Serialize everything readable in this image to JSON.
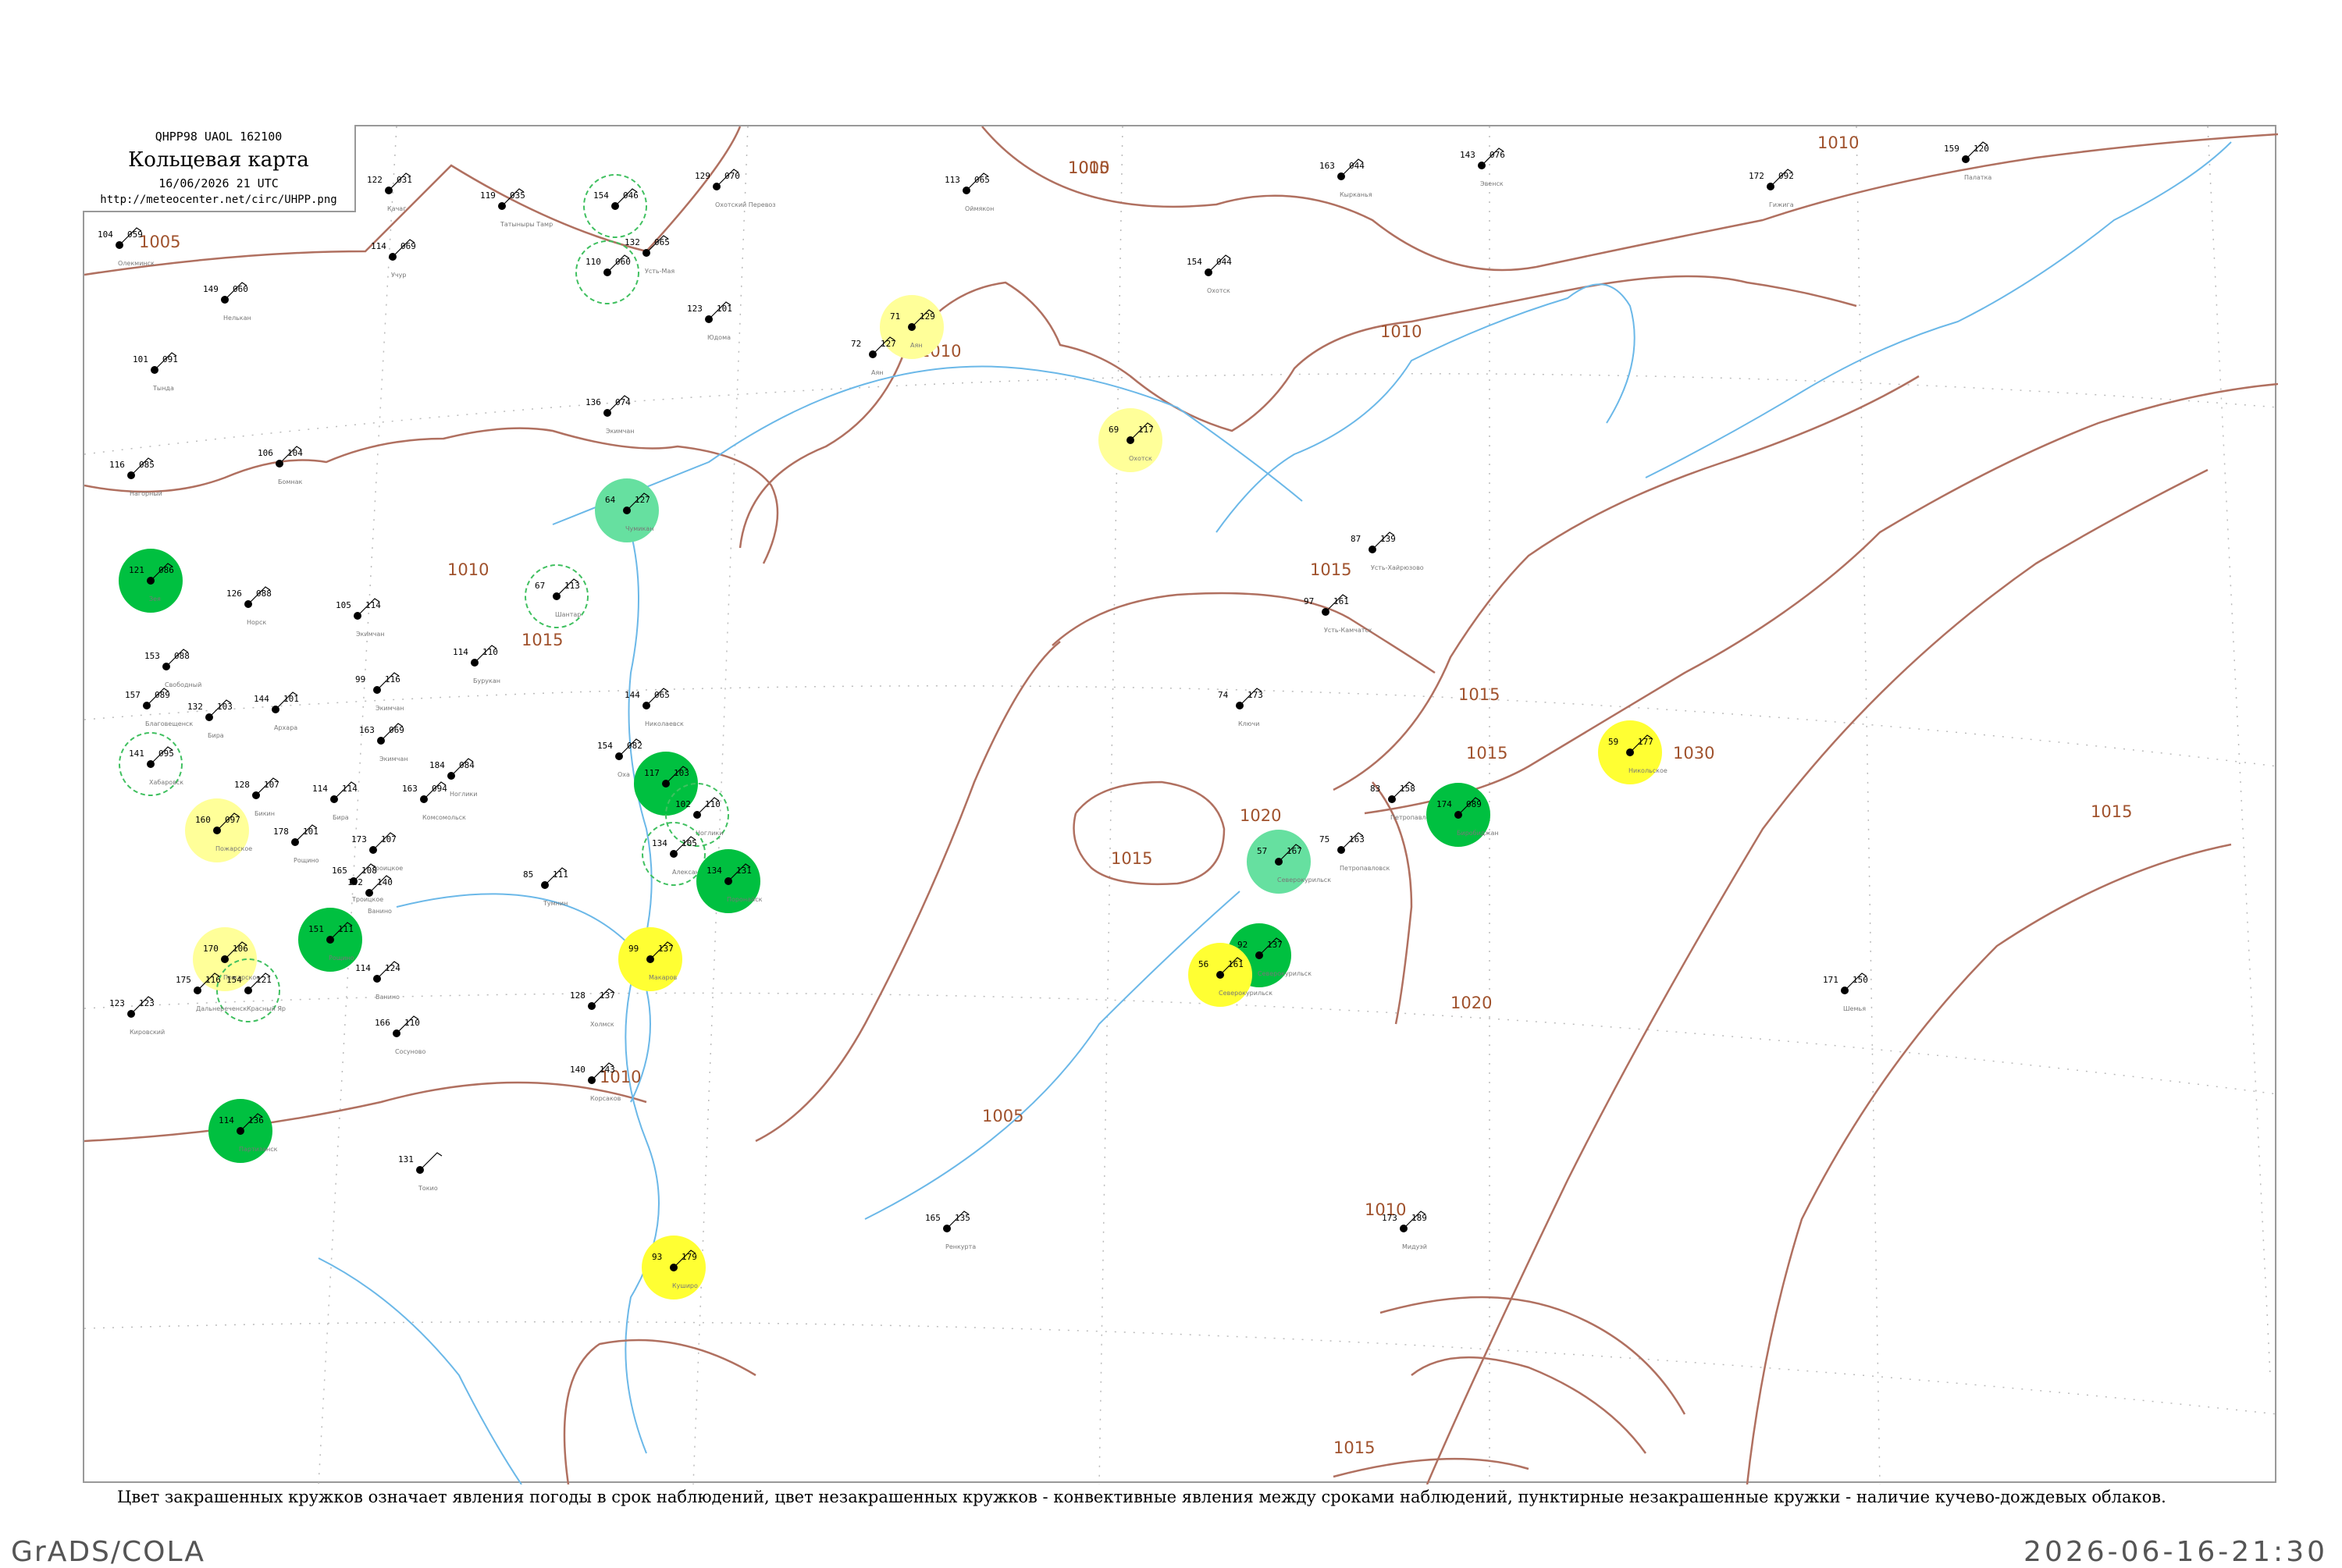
{
  "header": {
    "code_line": "QHPP98  UAOL  162100",
    "title": "Кольцевая карта",
    "date_line": "16/06/2026 21 UTC",
    "url": "http://meteocenter.net/circ/UHPP.png"
  },
  "caption": "Цвет закрашенных кружков означает явления погоды в срок наблюдений, цвет незакрашенных кружков - конвективные явления между сроками наблюдений, пунктирные незакрашенные кружки - наличие кучево-дождевых облаков.",
  "footer": {
    "left": "GrADS/COLA",
    "right": "2026-06-16-21:30"
  },
  "colors": {
    "isobar": "#b07060",
    "river": "#6bb8e8",
    "coast": "#b07060",
    "green_dark": "#00c040",
    "green_light": "#66e0a0",
    "yellow": "#ffff33",
    "yellow_light": "#ffff99",
    "grid": "#bbbbbb",
    "station_name": "#777777"
  },
  "isobar_labels": [
    "1005",
    "1010",
    "1010",
    "1005",
    "1010",
    "1010",
    "1010",
    "1015",
    "1015",
    "1015",
    "1015",
    "1015",
    "1020",
    "1030",
    "1015",
    "1010",
    "1005",
    "1020",
    "1010",
    "1015"
  ],
  "stations": [
    {
      "t": "154",
      "p": "046",
      "name": "",
      "marker": "dash-green"
    },
    {
      "t": "110",
      "p": "060",
      "name": "",
      "marker": "dash-green"
    },
    {
      "t": "132",
      "p": "065",
      "name": "Усть-Мая"
    },
    {
      "t": "129",
      "p": "070",
      "name": "Охотский Перевоз"
    },
    {
      "t": "113",
      "p": "065",
      "name": "Оймякон"
    },
    {
      "t": "163",
      "p": "044",
      "name": "Кырканья"
    },
    {
      "t": "143",
      "p": "076",
      "name": "Эвенск"
    },
    {
      "t": "172",
      "p": "092",
      "name": "Гижига"
    },
    {
      "t": "159",
      "p": "120",
      "name": "Палатка"
    },
    {
      "t": "122",
      "p": "031",
      "name": "Качаг"
    },
    {
      "t": "119",
      "p": "035",
      "name": "Татыныры Тамр"
    },
    {
      "t": "104",
      "p": "059",
      "name": "Олекминск"
    },
    {
      "t": "114",
      "p": "069",
      "name": "Учур"
    },
    {
      "t": "149",
      "p": "060",
      "name": "Нелькан"
    },
    {
      "t": "71",
      "p": "129",
      "name": "Аян",
      "marker": "yellow-light"
    },
    {
      "t": "72",
      "p": "127",
      "name": "Аян"
    },
    {
      "t": "123",
      "p": "101",
      "name": "Юдома"
    },
    {
      "t": "154",
      "p": "044",
      "name": "Охотск"
    },
    {
      "t": "101",
      "p": "091",
      "name": "Тында"
    },
    {
      "t": "136",
      "p": "074",
      "name": "Экимчан"
    },
    {
      "t": "106",
      "p": "104",
      "name": "Бомнак"
    },
    {
      "t": "116",
      "p": "085",
      "name": "Нагорный"
    },
    {
      "t": "64",
      "p": "127",
      "name": "Чумикан",
      "marker": "green-light"
    },
    {
      "t": "69",
      "p": "117",
      "name": "Охотск",
      "marker": "yellow-light"
    },
    {
      "t": "87",
      "p": "139",
      "name": "Усть-Хайрюзово"
    },
    {
      "t": "97",
      "p": "161",
      "name": "Усть-Камчатск"
    },
    {
      "t": "121",
      "p": "086",
      "name": "Зея",
      "marker": "green-dark"
    },
    {
      "t": "126",
      "p": "088",
      "name": "Норск"
    },
    {
      "t": "105",
      "p": "114",
      "name": "Экимчан"
    },
    {
      "t": "67",
      "p": "113",
      "name": "Шантар",
      "marker": "dash-green"
    },
    {
      "t": "74",
      "p": "173",
      "name": "Ключи"
    },
    {
      "t": "153",
      "p": "088",
      "name": "Свободный"
    },
    {
      "t": "99",
      "p": "116",
      "name": "Экимчан"
    },
    {
      "t": "114",
      "p": "110",
      "name": "Бурукан"
    },
    {
      "t": "157",
      "p": "089",
      "name": "Благовещенск"
    },
    {
      "t": "144",
      "p": "101",
      "name": "Архара"
    },
    {
      "t": "132",
      "p": "103",
      "name": "Бира"
    },
    {
      "t": "163",
      "p": "069",
      "name": "Экимчан"
    },
    {
      "t": "144",
      "p": "065",
      "name": "Николаевск"
    },
    {
      "t": "154",
      "p": "082",
      "name": "Оха"
    },
    {
      "t": "141",
      "p": "095",
      "name": "Хабаровск",
      "marker": "dash-green"
    },
    {
      "t": "128",
      "p": "107",
      "name": "Бикин"
    },
    {
      "t": "114",
      "p": "114",
      "name": "Бира"
    },
    {
      "t": "184",
      "p": "084",
      "name": "Ноглики"
    },
    {
      "t": "163",
      "p": "094",
      "name": "Комсомольск"
    },
    {
      "t": "117",
      "p": "103",
      "name": "",
      "marker": "green-dark"
    },
    {
      "t": "102",
      "p": "110",
      "name": "Ноглики",
      "marker": "dash-green"
    },
    {
      "t": "83",
      "p": "158",
      "name": "Петропавловск"
    },
    {
      "t": "59",
      "p": "177",
      "name": "Никольское",
      "marker": "yellow"
    },
    {
      "t": "174",
      "p": "089",
      "name": "Биробиджан",
      "marker": "green-dark"
    },
    {
      "t": "160",
      "p": "097",
      "name": "Пожарское",
      "marker": "yellow-light"
    },
    {
      "t": "178",
      "p": "101",
      "name": "Рощино"
    },
    {
      "t": "173",
      "p": "107",
      "name": "Троицкое"
    },
    {
      "t": "134",
      "p": "105",
      "name": "Александровск",
      "marker": "dash-green"
    },
    {
      "t": "134",
      "p": "131",
      "name": "Поронайск",
      "marker": "green-dark"
    },
    {
      "t": "57",
      "p": "167",
      "name": "Северокурильск",
      "marker": "green-light"
    },
    {
      "t": "75",
      "p": "163",
      "name": "Петропавловск"
    },
    {
      "t": "165",
      "p": "108",
      "name": "Троицкое"
    },
    {
      "t": "85",
      "p": "111",
      "name": "Тумнин"
    },
    {
      "t": "102",
      "p": "140",
      "name": "Ванино"
    },
    {
      "t": "151",
      "p": "111",
      "name": "Рощино",
      "marker": "green-dark"
    },
    {
      "t": "170",
      "p": "106",
      "name": "Пожарское",
      "marker": "yellow-light"
    },
    {
      "t": "154",
      "p": "121",
      "name": "Красный Яр",
      "marker": "dash-green"
    },
    {
      "t": "99",
      "p": "137",
      "name": "Макаров",
      "marker": "yellow"
    },
    {
      "t": "92",
      "p": "137",
      "name": "Северокурильск",
      "marker": "green-dark"
    },
    {
      "t": "56",
      "p": "161",
      "name": "Северокурильск",
      "marker": "yellow"
    },
    {
      "t": "175",
      "p": "116",
      "name": "Дальнереченск"
    },
    {
      "t": "123",
      "p": "123",
      "name": "Кировский"
    },
    {
      "t": "114",
      "p": "124",
      "name": "Ванино"
    },
    {
      "t": "128",
      "p": "137",
      "name": "Холмск"
    },
    {
      "t": "166",
      "p": "110",
      "name": "Сосуново"
    },
    {
      "t": "140",
      "p": "143",
      "name": "Корсаков"
    },
    {
      "t": "114",
      "p": "136",
      "name": "Партизанск",
      "marker": "green-dark"
    },
    {
      "t": "171",
      "p": "150",
      "name": "Шемья"
    },
    {
      "t": "131",
      "p": "",
      "name": "Токио"
    },
    {
      "t": "165",
      "p": "135",
      "name": "Ренкурта"
    },
    {
      "t": "93",
      "p": "179",
      "name": "Куширо",
      "marker": "yellow"
    },
    {
      "t": "173",
      "p": "189",
      "name": "Мидуэй"
    }
  ]
}
